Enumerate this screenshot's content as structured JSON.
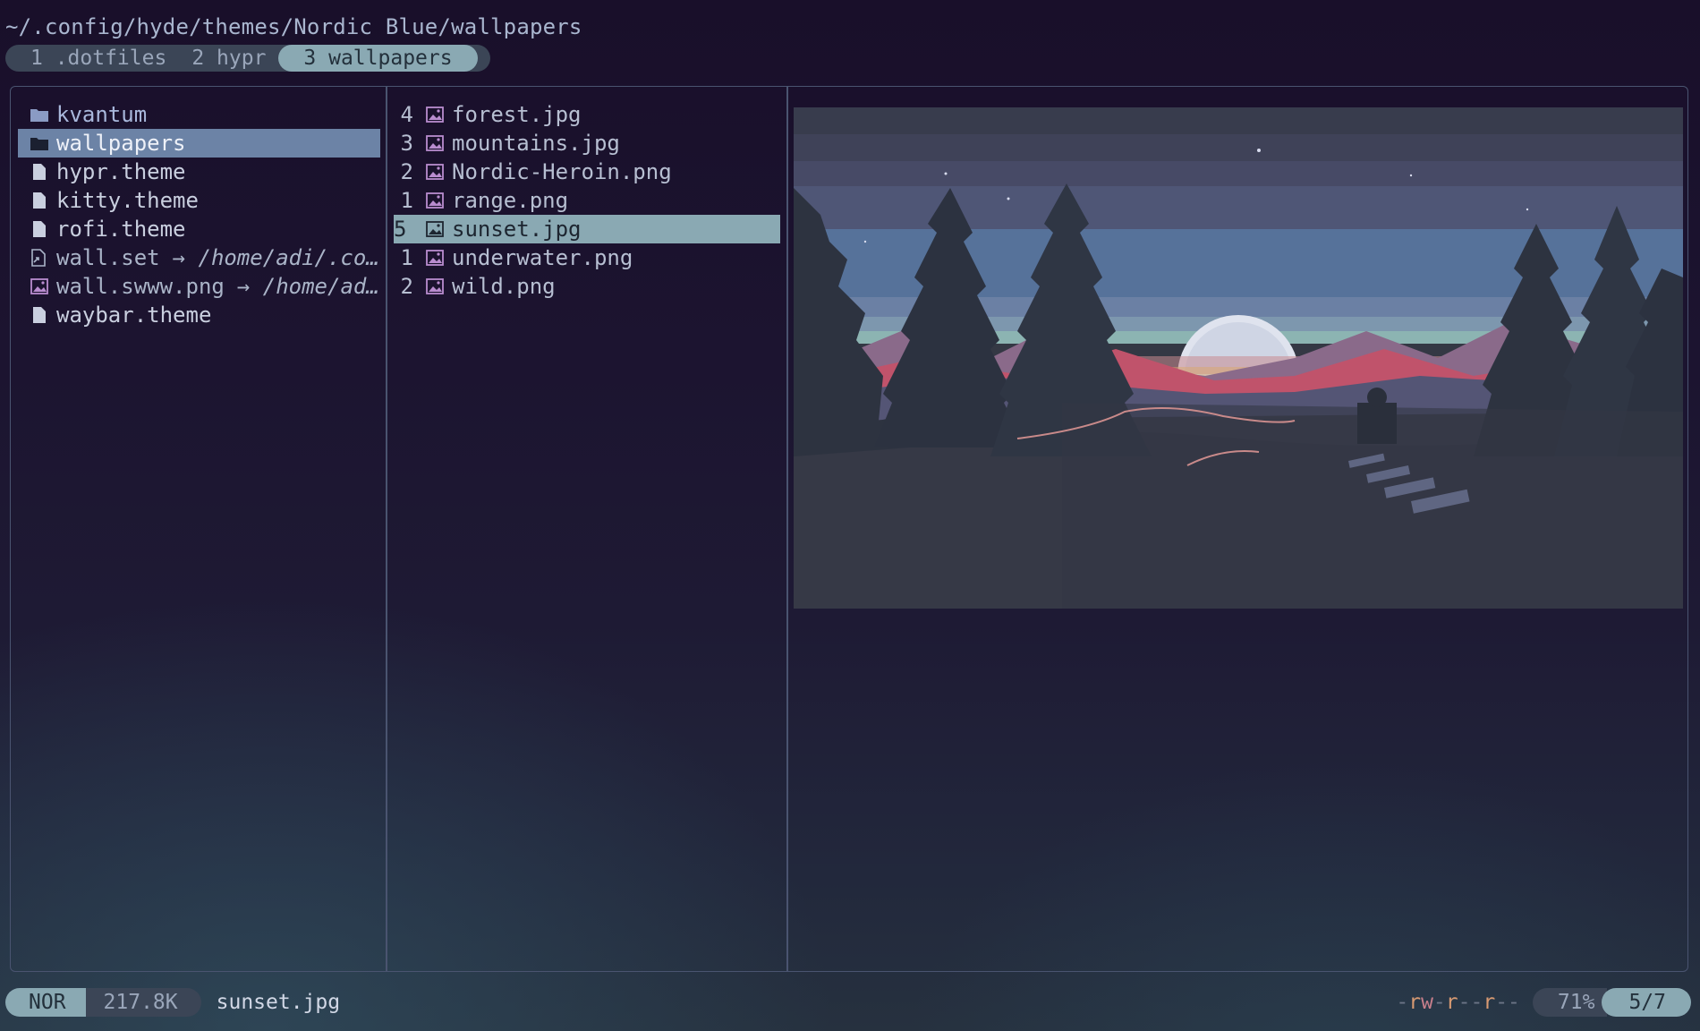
{
  "header": {
    "path": "~/.config/hyde/themes/Nordic Blue/wallpapers",
    "tabs": [
      {
        "label": "1 .dotfiles"
      },
      {
        "label": "2 hypr"
      },
      {
        "label": "3 wallpapers",
        "active": true
      }
    ]
  },
  "parent_pane": {
    "items": [
      {
        "name": "kvantum",
        "icon": "folder-icon"
      },
      {
        "name": "wallpapers",
        "icon": "folder-icon",
        "selected": true
      },
      {
        "name": "hypr.theme",
        "icon": "file-icon"
      },
      {
        "name": "kitty.theme",
        "icon": "file-icon"
      },
      {
        "name": "rofi.theme",
        "icon": "file-icon"
      },
      {
        "name": "wall.set",
        "icon": "symlink-file-icon",
        "link": "→ /home/adi/.co…"
      },
      {
        "name": "wall.swww.png",
        "icon": "image-icon",
        "link": "→ /home/ad…"
      },
      {
        "name": "waybar.theme",
        "icon": "file-icon"
      }
    ]
  },
  "current_pane": {
    "items": [
      {
        "num": "4",
        "name": "forest.jpg",
        "icon": "image-icon"
      },
      {
        "num": "3",
        "name": "mountains.jpg",
        "icon": "image-icon"
      },
      {
        "num": "2",
        "name": "Nordic-Heroin.png",
        "icon": "image-icon"
      },
      {
        "num": "1",
        "name": "range.png",
        "icon": "image-icon"
      },
      {
        "num": "5",
        "name": "sunset.jpg",
        "icon": "image-icon",
        "selected": true
      },
      {
        "num": "1",
        "name": "underwater.png",
        "icon": "image-icon"
      },
      {
        "num": "2",
        "name": "wild.png",
        "icon": "image-icon"
      }
    ]
  },
  "preview": {
    "icon": "sunset-wallpaper-image"
  },
  "status": {
    "mode": "NOR",
    "size": "217.8K",
    "filename": "sunset.jpg",
    "permissions": "-rw-r--r--",
    "percent": "71%",
    "position": "5/7"
  },
  "colors": {
    "accent": "#8aa9b3",
    "selection": "#6c83a6",
    "pill": "#3b4556",
    "border": "#4a5470",
    "perm_read": "#d89a72",
    "perm_write": "#c77f8c"
  }
}
